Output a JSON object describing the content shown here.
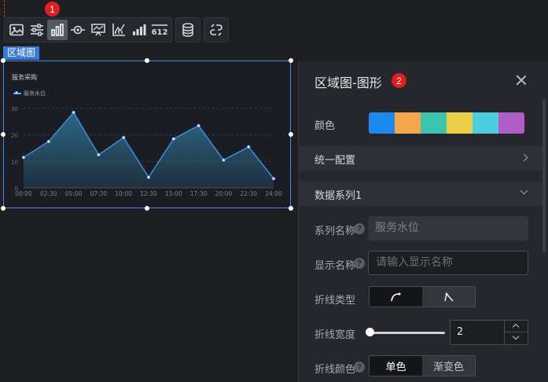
{
  "toolbar": {
    "groups": [
      [
        "image-icon",
        "sliders-icon",
        "bar-chart-icon",
        "eye-target-icon",
        "monitor-chart-icon",
        "axis-chart-icon",
        "mini-bars-icon",
        "number-icon"
      ],
      [
        "database-icon"
      ],
      [
        "link-swap-icon"
      ]
    ],
    "active": "bar-chart-icon",
    "number_icon_text": "612"
  },
  "markers": {
    "one": "1",
    "two": "2"
  },
  "component": {
    "tag": "区域图"
  },
  "chart_data": {
    "type": "area",
    "title": "服务采购",
    "series": [
      {
        "name": "服务水位",
        "values": [
          11.5,
          17.5,
          28.5,
          12.5,
          19,
          4,
          18.5,
          23.5,
          10.5,
          15.5,
          3.5
        ]
      }
    ],
    "x": [
      "00:00",
      "02:30",
      "05:00",
      "07:30",
      "10:00",
      "12:30",
      "15:00",
      "17:30",
      "20:00",
      "22:30",
      "24:00"
    ],
    "y_ticks": [
      "0",
      "10",
      "20",
      "30"
    ],
    "ylim": [
      0,
      30
    ],
    "grid": true,
    "legend": "top-left",
    "colors": {
      "line": "#3d8fe0",
      "fill": "#2d6a8a"
    }
  },
  "panel": {
    "title": "区域图-图形",
    "color_label": "颜色",
    "palette": [
      "#1e88f0",
      "#f5a54a",
      "#3cc4ac",
      "#eccf47",
      "#4dcde0",
      "#b05ec7"
    ],
    "unified_config": "统一配置",
    "series_section": "数据系列1",
    "series_name_label": "系列名称",
    "series_name_value": "服务水位",
    "display_name_label": "显示名称",
    "display_name_placeholder": "请输入显示名称",
    "line_type_label": "折线类型",
    "line_width_label": "折线宽度",
    "line_width_value": "2",
    "line_width_fraction": 0.0,
    "line_color_label": "折线颜色",
    "line_color_options": [
      "单色",
      "渐变色"
    ],
    "line_color_selected": "单色",
    "help_glyph": "?"
  }
}
